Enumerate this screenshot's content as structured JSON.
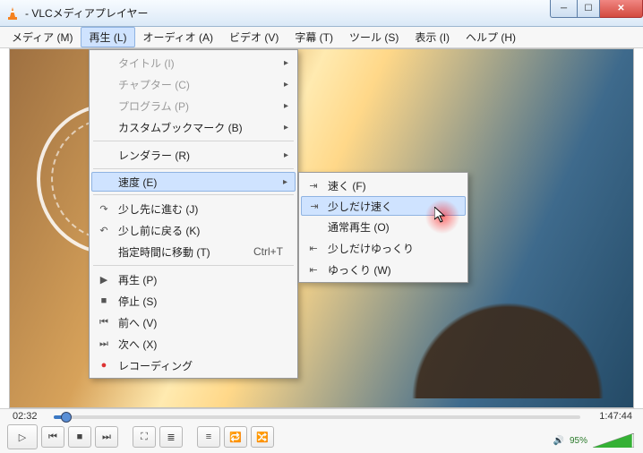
{
  "title": "- VLCメディアプレイヤー",
  "menubar": [
    "メディア (M)",
    "再生 (L)",
    "オーディオ (A)",
    "ビデオ (V)",
    "字幕 (T)",
    "ツール (S)",
    "表示 (I)",
    "ヘルプ (H)"
  ],
  "playMenu": {
    "title": "タイトル (I)",
    "chapter": "チャプター (C)",
    "program": "プログラム (P)",
    "bookmarks": "カスタムブックマーク (B)",
    "renderer": "レンダラー (R)",
    "speed": "速度 (E)",
    "jumpFwd": "少し先に進む (J)",
    "jumpBwd": "少し前に戻る (K)",
    "gotoTime": "指定時間に移動 (T)",
    "gotoTimeShortcut": "Ctrl+T",
    "play": "再生 (P)",
    "stop": "停止 (S)",
    "prev": "前へ (V)",
    "next": "次へ (X)",
    "record": "レコーディング"
  },
  "speedMenu": {
    "faster": "速く (F)",
    "fineFaster": "少しだけ速く",
    "normal": "通常再生 (O)",
    "fineSlower": "少しだけゆっくり",
    "slower": "ゆっくり (W)"
  },
  "time": {
    "current": "02:32",
    "total": "1:47:44",
    "progressPercent": 2.4
  },
  "volume": {
    "percent": "95%"
  },
  "icons": {
    "submenu": "▸",
    "jumpF": "↷",
    "jumpB": "↶",
    "play": "▶",
    "stop": "■",
    "prev": "⏮",
    "next": "⏭",
    "record": "●",
    "speedFast": "⇥",
    "speedSlow": "⇤",
    "btnPlay": "▷",
    "btnPrev": "⏮",
    "btnStop": "■",
    "btnNext": "⏭",
    "btnFull": "⛶",
    "btnExt": "≣",
    "btnPlaylist": "≡",
    "btnLoop": "🔁",
    "btnShuffle": "🔀",
    "speaker": "🔊"
  }
}
